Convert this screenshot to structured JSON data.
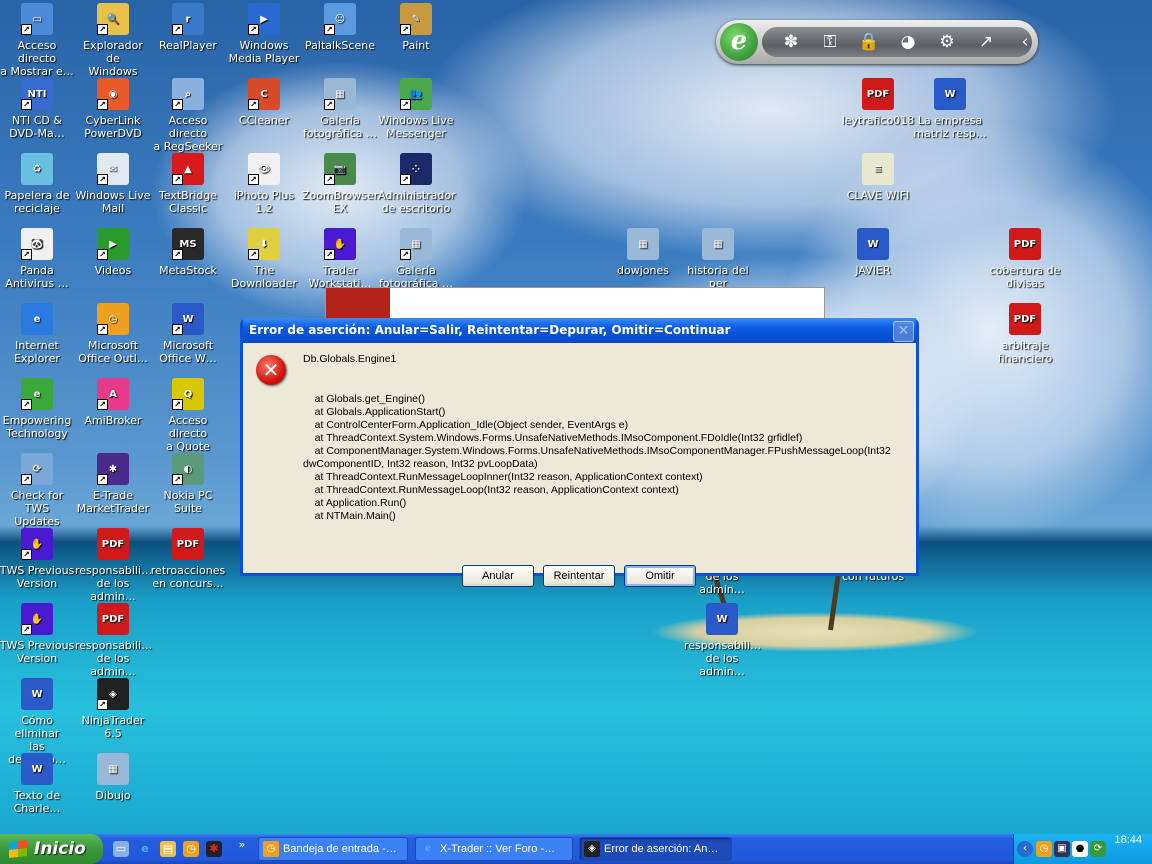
{
  "desktop": {
    "icons": [
      {
        "label": "Acceso directo\na Mostrar e…",
        "icon": "show-desktop-icon",
        "color": "#4a8ad8",
        "glyph": "▭",
        "shortcut": true
      },
      {
        "label": "Explorador de\nWindows",
        "icon": "folder-search-icon",
        "color": "#e8c04a",
        "glyph": "🔍",
        "shortcut": true
      },
      {
        "label": "RealPlayer",
        "icon": "realplayer-icon",
        "color": "#3a78c8",
        "glyph": "r",
        "shortcut": true
      },
      {
        "label": "Windows\nMedia Player",
        "icon": "media-player-icon",
        "color": "#2a6ad0",
        "glyph": "▶",
        "shortcut": true
      },
      {
        "label": "PaltalkScene",
        "icon": "paltalk-icon",
        "color": "#5a9ae0",
        "glyph": "☺",
        "shortcut": true
      },
      {
        "label": "Paint",
        "icon": "paint-icon",
        "color": "#c89a40",
        "glyph": "✎",
        "shortcut": true
      },
      {
        "label": "NTI CD &\nDVD-Ma…",
        "icon": "nti-cd-icon",
        "color": "#3a6ad0",
        "glyph": "NTI",
        "shortcut": true
      },
      {
        "label": "CyberLink\nPowerDVD",
        "icon": "powerdvd-icon",
        "color": "#e85a2a",
        "glyph": "◉",
        "shortcut": true
      },
      {
        "label": "Acceso directo\na RegSeeker",
        "icon": "regseeker-icon",
        "color": "#8ab0e0",
        "glyph": "⌕",
        "shortcut": true
      },
      {
        "label": "CCleaner",
        "icon": "ccleaner-icon",
        "color": "#d84a2a",
        "glyph": "C",
        "shortcut": true
      },
      {
        "label": "Galería\nfotográfica …",
        "icon": "photo-gallery-icon",
        "color": "#9ab8d8",
        "glyph": "▦",
        "shortcut": true
      },
      {
        "label": "Windows Live\nMessenger",
        "icon": "messenger-icon",
        "color": "#4aa84a",
        "glyph": "👥",
        "shortcut": true
      },
      {
        "label": "Papelera de\nreciclaje",
        "icon": "recycle-bin-icon",
        "color": "#6ac0e0",
        "glyph": "♻",
        "shortcut": false
      },
      {
        "label": "Windows Live\nMail",
        "icon": "live-mail-icon",
        "color": "#e0e8f0",
        "glyph": "✉",
        "shortcut": true
      },
      {
        "label": "TextBridge\nClassic",
        "icon": "textbridge-icon",
        "color": "#d81a1a",
        "glyph": "▲",
        "shortcut": true
      },
      {
        "label": "iPhoto Plus 1.2",
        "icon": "iphoto-icon",
        "color": "#f0f0f0",
        "glyph": "👁",
        "shortcut": true
      },
      {
        "label": "ZoomBrowser\nEX",
        "icon": "zoombrowser-icon",
        "color": "#4a8a4a",
        "glyph": "📷",
        "shortcut": true
      },
      {
        "label": "Administrador\nde escritorio",
        "icon": "blackberry-icon",
        "color": "#1a2a6a",
        "glyph": "⁘",
        "shortcut": true
      },
      {
        "label": "Panda\nAntivirus …",
        "icon": "panda-icon",
        "color": "#f0f0f0",
        "glyph": "🐼",
        "shortcut": true
      },
      {
        "label": "Videos",
        "icon": "videos-icon",
        "color": "#2a9a2a",
        "glyph": "▶",
        "shortcut": true
      },
      {
        "label": "MetaStock",
        "icon": "metastock-icon",
        "color": "#2a2a2a",
        "glyph": "MS",
        "shortcut": true
      },
      {
        "label": "The\nDownloader",
        "icon": "downloader-icon",
        "color": "#e0d040",
        "glyph": "⬇",
        "shortcut": true
      },
      {
        "label": "Trader\nWorkstati…",
        "icon": "trader-workstation-icon",
        "color": "#4a1ad0",
        "glyph": "✋",
        "shortcut": true
      },
      {
        "label": "Galería\nfotográfica …",
        "icon": "photo-gallery-icon",
        "color": "#9ab8d8",
        "glyph": "▦",
        "shortcut": true
      },
      {
        "label": "Internet\nExplorer",
        "icon": "internet-explorer-icon",
        "color": "#2a7ae0",
        "glyph": "e",
        "shortcut": false
      },
      {
        "label": "Microsoft\nOffice Outl…",
        "icon": "outlook-icon",
        "color": "#f0a020",
        "glyph": "◷",
        "shortcut": true
      },
      {
        "label": "Microsoft\nOffice W…",
        "icon": "word-icon",
        "color": "#2a5ac8",
        "glyph": "W",
        "shortcut": true
      },
      {
        "label": "Empowering\nTechnology",
        "icon": "empowering-technology-icon",
        "color": "#3aa83a",
        "glyph": "e",
        "shortcut": true
      },
      {
        "label": "AmiBroker",
        "icon": "amibroker-icon",
        "color": "#e83a8a",
        "glyph": "A",
        "shortcut": true
      },
      {
        "label": "Acceso directo\na Quote",
        "icon": "quote-icon",
        "color": "#d8c800",
        "glyph": "Q",
        "shortcut": true
      },
      {
        "label": "Check for TWS\nUpdates",
        "icon": "tws-update-icon",
        "color": "#7aa8d8",
        "glyph": "⟳",
        "shortcut": true
      },
      {
        "label": "E-Trade\nMarketTrader",
        "icon": "etrade-icon",
        "color": "#4a2a8a",
        "glyph": "✱",
        "shortcut": true
      },
      {
        "label": "Nokia PC Suite",
        "icon": "nokia-icon",
        "color": "#5a9a7a",
        "glyph": "◐",
        "shortcut": true
      },
      {
        "label": "TWS Previous\nVersion",
        "icon": "tws-icon",
        "color": "#4a1ad0",
        "glyph": "✋",
        "shortcut": true
      },
      {
        "label": "responsabili…\nde los admin…",
        "icon": "pdf-icon",
        "color": "#d01a1a",
        "glyph": "PDF",
        "shortcut": false
      },
      {
        "label": "retroacciones\nen concurs…",
        "icon": "pdf-icon",
        "color": "#d01a1a",
        "glyph": "PDF",
        "shortcut": false
      },
      {
        "label": "TWS Previous\nVersion",
        "icon": "tws-icon",
        "color": "#4a1ad0",
        "glyph": "✋",
        "shortcut": true
      },
      {
        "label": "responsabili…\nde los admin…",
        "icon": "pdf-icon",
        "color": "#d01a1a",
        "glyph": "PDF",
        "shortcut": false
      },
      {
        "label": "Cómo eliminar\nlas deteccio…",
        "icon": "word-doc-icon",
        "color": "#2a5ac8",
        "glyph": "W",
        "shortcut": false
      },
      {
        "label": "NinjaTrader\n6.5",
        "icon": "ninjatrader-icon",
        "color": "#222",
        "glyph": "◈",
        "shortcut": true
      },
      {
        "label": "Texto de\nCharle…",
        "icon": "word-doc-icon",
        "color": "#2a5ac8",
        "glyph": "W",
        "shortcut": false
      },
      {
        "label": "Dibujo",
        "icon": "image-file-icon",
        "color": "#9ab8d8",
        "glyph": "▦",
        "shortcut": false
      },
      {
        "label": "leytrafico018",
        "icon": "pdf-icon",
        "color": "#d01a1a",
        "glyph": "PDF",
        "shortcut": false
      },
      {
        "label": "La empresa\nmatriz resp…",
        "icon": "word-doc-icon",
        "color": "#2a5ac8",
        "glyph": "W",
        "shortcut": false
      },
      {
        "label": "CLAVE WIFI",
        "icon": "notepad-icon",
        "color": "#e8e8d0",
        "glyph": "≡",
        "shortcut": false
      },
      {
        "label": "dowjones",
        "icon": "image-file-icon",
        "color": "#9ab8d8",
        "glyph": "▦",
        "shortcut": false
      },
      {
        "label": "historia del per\namericano",
        "icon": "image-file-icon",
        "color": "#9ab8d8",
        "glyph": "▦",
        "shortcut": false
      },
      {
        "label": "JAVIER",
        "icon": "word-doc-icon",
        "color": "#2a5ac8",
        "glyph": "W",
        "shortcut": false
      },
      {
        "label": "cobertura de\ndivisas",
        "icon": "pdf-icon",
        "color": "#d01a1a",
        "glyph": "PDF",
        "shortcut": false
      },
      {
        "label": "arbitraje\nfinanciero",
        "icon": "pdf-icon",
        "color": "#d01a1a",
        "glyph": "PDF",
        "shortcut": false
      },
      {
        "label": "\nde los admin…",
        "icon": "pdf-icon",
        "color": "#d01a1a",
        "glyph": "PDF",
        "shortcut": false
      },
      {
        "label": "\ncon futuros",
        "icon": "word-doc-icon",
        "color": "#2a5ac8",
        "glyph": "W",
        "shortcut": false
      },
      {
        "label": "responsabili…\nde los admin…",
        "icon": "word-doc-icon",
        "color": "#2a5ac8",
        "glyph": "W",
        "shortcut": false
      }
    ]
  },
  "toolbar": {
    "logo": "e",
    "buttons": [
      {
        "icon": "fan-icon",
        "glyph": "✽"
      },
      {
        "icon": "key-icon",
        "glyph": "⚿"
      },
      {
        "icon": "lock-icon",
        "glyph": "🔒"
      },
      {
        "icon": "globe-icon",
        "glyph": "◕"
      },
      {
        "icon": "gear-icon",
        "glyph": "⚙"
      },
      {
        "icon": "chart-line-icon",
        "glyph": "↗"
      },
      {
        "icon": "collapse-icon",
        "glyph": "‹"
      }
    ]
  },
  "dialog": {
    "title": "Error de aserción: Anular=Salir, Reintentar=Depurar, Omitir=Continuar",
    "close": "✕",
    "error_glyph": "✕",
    "header": "Db.Globals.Engine1",
    "stack": [
      "    at Globals.get_Engine()",
      "    at Globals.ApplicationStart()",
      "    at ControlCenterForm.Application_Idle(Object sender, EventArgs e)",
      "    at ThreadContext.System.Windows.Forms.UnsafeNativeMethods.IMsoComponent.FDoIdle(Int32 grfidlef)",
      "    at ComponentManager.System.Windows.Forms.UnsafeNativeMethods.IMsoComponentManager.FPushMessageLoop(Int32 dwComponentID, Int32 reason, Int32 pvLoopData)",
      "    at ThreadContext.RunMessageLoopInner(Int32 reason, ApplicationContext context)",
      "    at ThreadContext.RunMessageLoop(Int32 reason, ApplicationContext context)",
      "    at Application.Run()",
      "    at NTMain.Main()"
    ],
    "buttons": {
      "abort": "Anular",
      "retry": "Reintentar",
      "ignore": "Omitir"
    }
  },
  "taskbar": {
    "start": "Inicio",
    "quick_launch_more": "»",
    "tasks": [
      {
        "label": "Bandeja de entrada -…",
        "icon": "outlook-icon"
      },
      {
        "label": "X-Trader :: Ver Foro -…",
        "icon": "internet-explorer-icon"
      },
      {
        "label": "Error de aserción: An…",
        "icon": "ninjatrader-icon"
      }
    ],
    "clock": "18:44"
  }
}
